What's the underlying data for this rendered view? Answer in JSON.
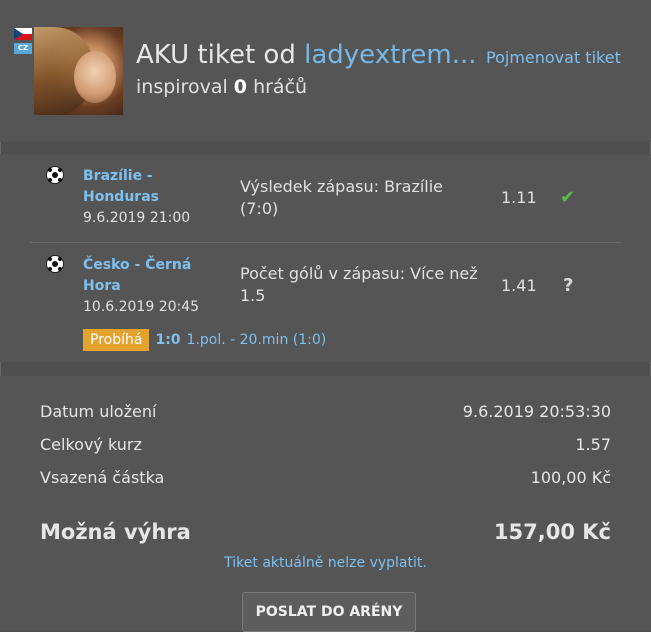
{
  "header": {
    "flag_country": "CZ",
    "title_prefix": "AKU tiket od ",
    "username": "ladyextrem...",
    "inspired_prefix": "inspiroval ",
    "inspired_count": "0",
    "inspired_suffix": " hráčů",
    "rename_link": "Pojmenovat tiket"
  },
  "bets": [
    {
      "match": "Brazílie - Honduras",
      "date": "9.6.2019 21:00",
      "pick": "Výsledek zápasu: Brazílie (7:0)",
      "odd": "1.11",
      "status_icon": "check-icon",
      "status_glyph": "✔"
    },
    {
      "match": "Česko - Černá Hora",
      "date": "10.6.2019 20:45",
      "pick": "Počet gólů v zápasu: Více než 1.5",
      "odd": "1.41",
      "status_icon": "question-icon",
      "status_glyph": "?",
      "live_badge": "Probíhá",
      "live_score": "1:0",
      "live_period": "1.pol. - 20.min (1:0)"
    }
  ],
  "summary": {
    "saved_label": "Datum uložení",
    "saved_value": "9.6.2019 20:53:30",
    "total_odds_label": "Celkový kurz",
    "total_odds_value": "1.57",
    "stake_label": "Vsazená částka",
    "stake_value": "100,00 Kč",
    "win_label": "Možná výhra",
    "win_value": "157,00 Kč",
    "note": "Tiket aktuálně nelze vyplatit.",
    "button": "POSLAT DO ARÉNY"
  },
  "colors": {
    "accent": "#7ec0ef",
    "badge": "#e3a32c",
    "success": "#5fb84b",
    "panel": "#555555",
    "background": "#4f4f4f"
  }
}
